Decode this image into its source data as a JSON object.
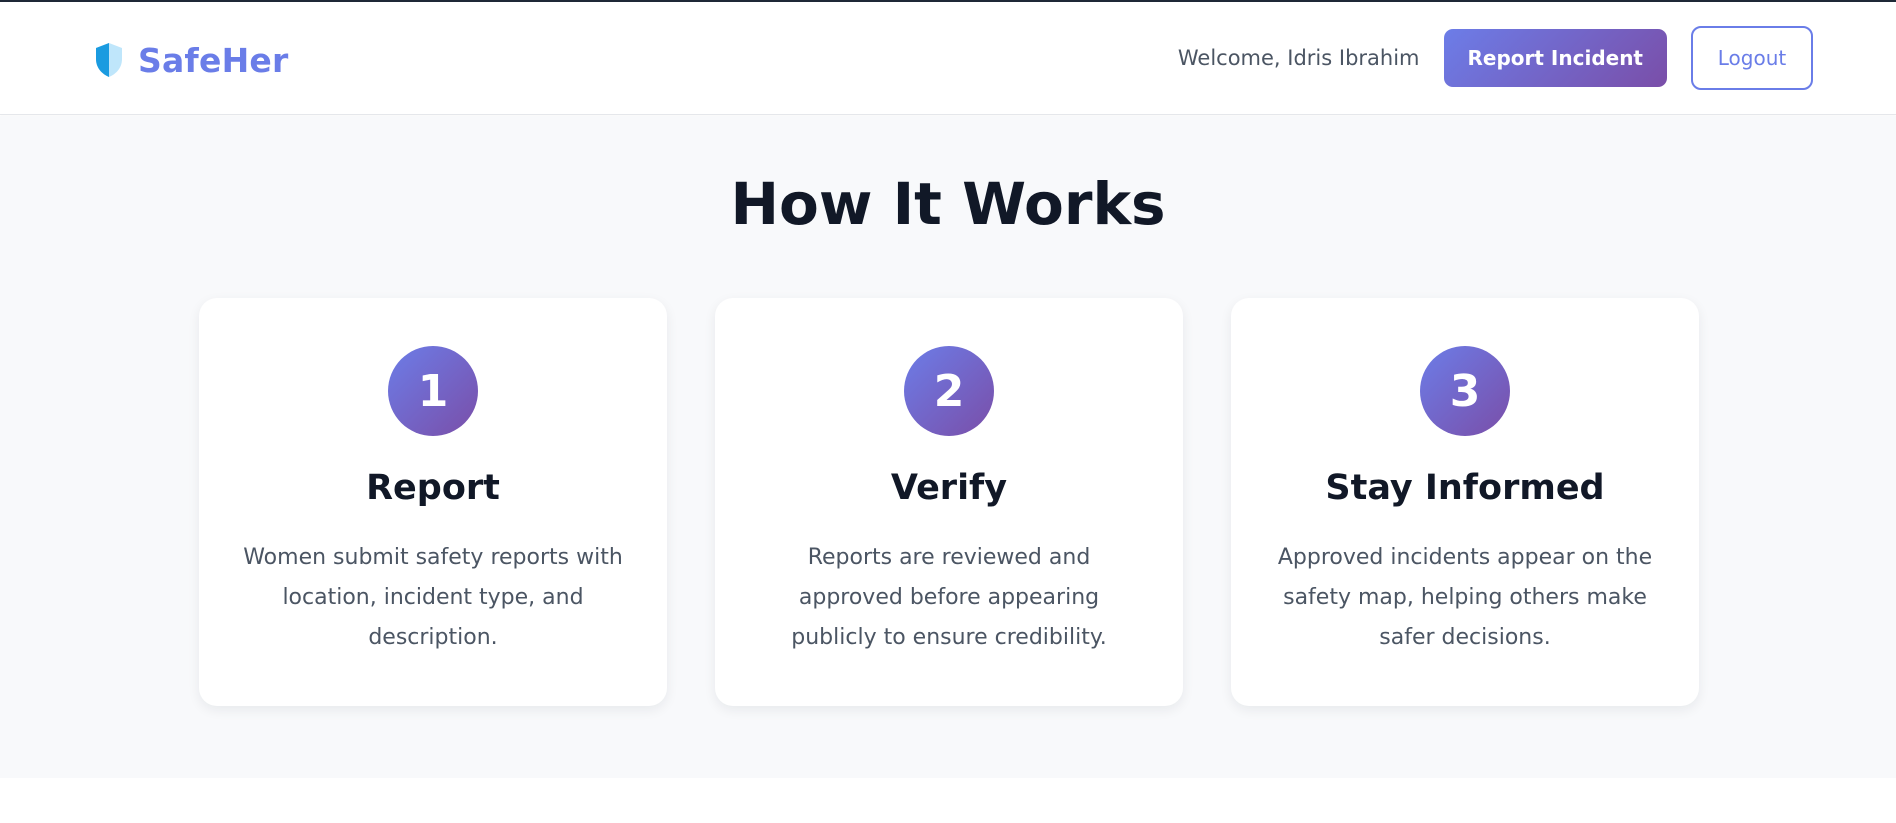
{
  "header": {
    "brand_name": "SafeHer",
    "brand_icon": "shield-icon",
    "welcome_text": "Welcome, Idris Ibrahim",
    "report_button_label": "Report Incident",
    "logout_button_label": "Logout"
  },
  "how_it_works": {
    "title": "How It Works",
    "steps": [
      {
        "number": "1",
        "title": "Report",
        "description": "Women submit safety reports with location, incident type, and description."
      },
      {
        "number": "2",
        "title": "Verify",
        "description": "Reports are reviewed and approved before appearing publicly to ensure credibility."
      },
      {
        "number": "3",
        "title": "Stay Informed",
        "description": "Approved incidents appear on the safety map, helping others make safer decisions."
      }
    ]
  },
  "colors": {
    "brand": "#6a7de8",
    "gradient_start": "#6c7de8",
    "gradient_end": "#7a4ea8",
    "heading": "#111827",
    "body_text": "#4b5563",
    "section_bg": "#f8f9fb"
  }
}
